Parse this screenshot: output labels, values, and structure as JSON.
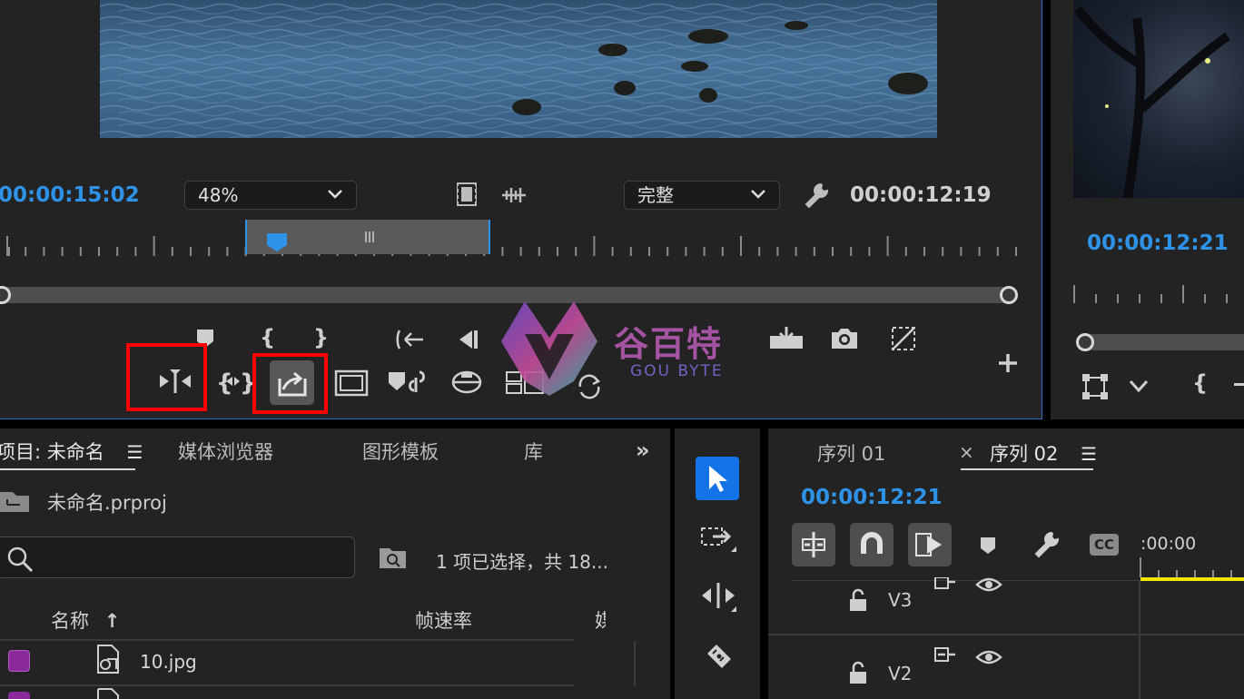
{
  "source_monitor": {
    "timecode_current": "00:00:15:02",
    "zoom_level": "48%",
    "quality": "完整",
    "timecode_duration": "00:00:12:19"
  },
  "program_monitor": {
    "timecode": "00:00:12:21"
  },
  "project_panel": {
    "tabs": [
      "项目: 未命名",
      "媒体浏览器",
      "图形模板",
      "库"
    ],
    "project_file": "未命名.prproj",
    "search_placeholder": "",
    "selection_status": "1 项已选择，共 18...",
    "columns": {
      "name": "名称",
      "frame_rate": "帧速率"
    },
    "items": [
      {
        "name": "10.jpg",
        "color": "#8a2a9c"
      }
    ]
  },
  "timeline": {
    "tabs": [
      "序列 01",
      "序列 02"
    ],
    "timecode": "00:00:12:21",
    "ruler_start": ":00:00",
    "tracks": [
      "V3",
      "V2"
    ]
  },
  "watermark": {
    "cn": "谷百特",
    "en": "GOU BYTE"
  },
  "colors": {
    "accent": "#2e93e6",
    "highlight": "#ff0000",
    "playhead_bar": "#f5e600"
  }
}
